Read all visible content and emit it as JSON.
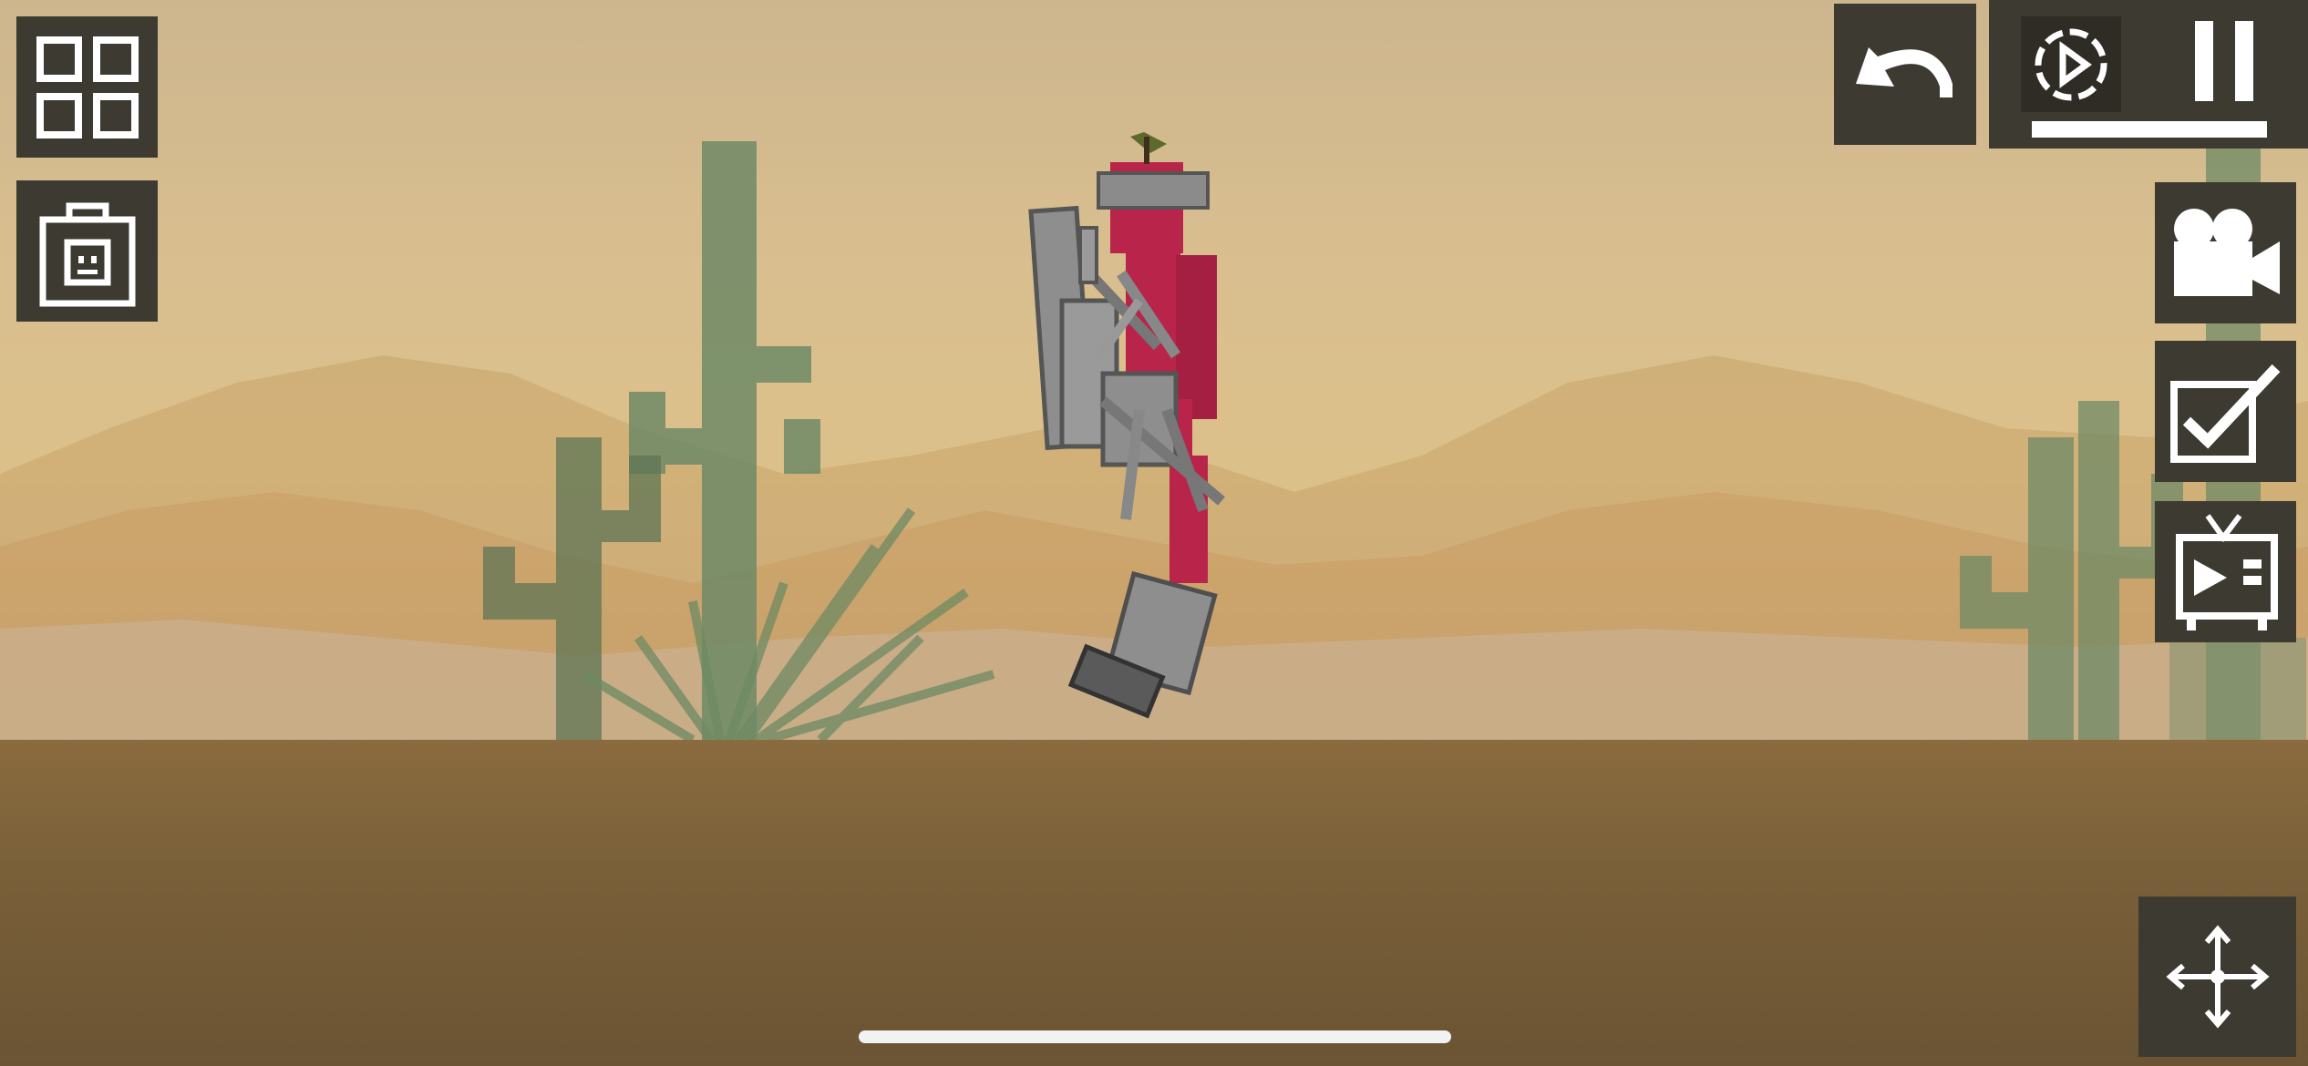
{
  "scene": {
    "name": "desert",
    "colors": {
      "sky": "#d9bf8f",
      "ground": "#7a6039",
      "cactus": "#6f8a66",
      "ragdoll": "#b8244a",
      "metal": "#8e8e8e"
    }
  },
  "hud": {
    "left": [
      {
        "id": "spawn-menu",
        "icon": "grid-icon"
      },
      {
        "id": "inventory",
        "icon": "bag-icon"
      }
    ],
    "top_right": [
      {
        "id": "undo",
        "icon": "undo-arrow-icon"
      },
      {
        "id": "slow-motion",
        "icon": "slowmo-play-icon"
      },
      {
        "id": "pause",
        "icon": "pause-icon"
      }
    ],
    "time_scale": 1.0,
    "right": [
      {
        "id": "camera",
        "icon": "camera-icon"
      },
      {
        "id": "select",
        "icon": "checkbox-icon"
      },
      {
        "id": "tv",
        "icon": "tv-icon"
      }
    ],
    "bottom_right": {
      "id": "move-tool",
      "icon": "move-arrows-icon"
    }
  }
}
